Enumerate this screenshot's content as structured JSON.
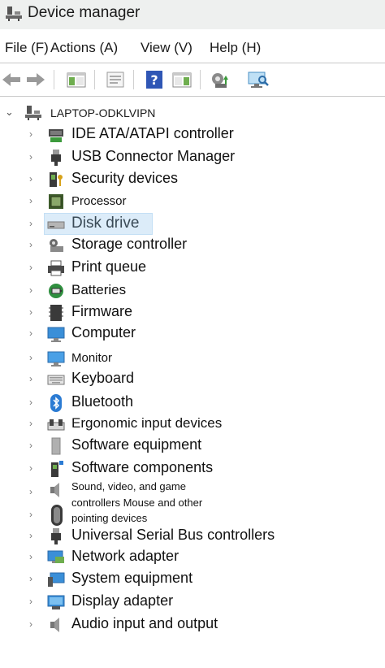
{
  "window": {
    "title": "Device manager"
  },
  "menu": {
    "items": [
      "File (F)",
      "Actions (A)",
      "View (V)",
      "Help (H)"
    ]
  },
  "toolbar": {
    "buttons": [
      "back-arrow-icon",
      "forward-arrow-icon",
      "show-hide-tree-icon",
      "properties-icon",
      "help-icon",
      "action-pane-icon",
      "update-driver-icon",
      "scan-hardware-icon"
    ]
  },
  "tree": {
    "root": "LAPTOP-ODKLVIPN",
    "nodes": [
      {
        "label": "IDE ATA/ATAPI controller",
        "icon": "ide-controller-icon"
      },
      {
        "label": "USB Connector Manager",
        "icon": "usb-plug-icon"
      },
      {
        "label": "Security devices",
        "icon": "security-key-icon"
      },
      {
        "label": "Processor",
        "icon": "processor-icon"
      },
      {
        "label": "Disk drive",
        "icon": "disk-drive-icon",
        "selected": true
      },
      {
        "label": "Storage controller",
        "icon": "storage-controller-icon"
      },
      {
        "label": "Print queue",
        "icon": "printer-icon"
      },
      {
        "label": "Batteries",
        "icon": "battery-icon"
      },
      {
        "label": "Firmware",
        "icon": "firmware-chip-icon"
      },
      {
        "label": "Computer",
        "icon": "computer-icon"
      },
      {
        "label": "Monitor",
        "icon": "monitor-icon"
      },
      {
        "label": "Keyboard",
        "icon": "keyboard-icon"
      },
      {
        "label": "Bluetooth",
        "icon": "bluetooth-icon"
      },
      {
        "label": "Ergonomic input devices",
        "icon": "ergonomic-input-icon"
      },
      {
        "label": "Software equipment",
        "icon": "software-device-icon"
      },
      {
        "label": "Software components",
        "icon": "software-component-icon"
      }
    ],
    "multiline": {
      "line1": "Sound, video, and game",
      "line2": "controllers Mouse and other",
      "line3": "pointing devices"
    },
    "nodes_after": [
      {
        "label": "Universal Serial Bus controllers",
        "icon": "usb-controller-icon"
      },
      {
        "label": "Network adapter",
        "icon": "network-adapter-icon"
      },
      {
        "label": "System equipment",
        "icon": "system-device-icon"
      },
      {
        "label": "Display adapter",
        "icon": "display-adapter-icon"
      },
      {
        "label": "Audio input and output",
        "icon": "audio-io-icon"
      }
    ]
  },
  "colors": {
    "selection_bg": "#dcecf9",
    "accent_blue": "#2b7bd3"
  }
}
